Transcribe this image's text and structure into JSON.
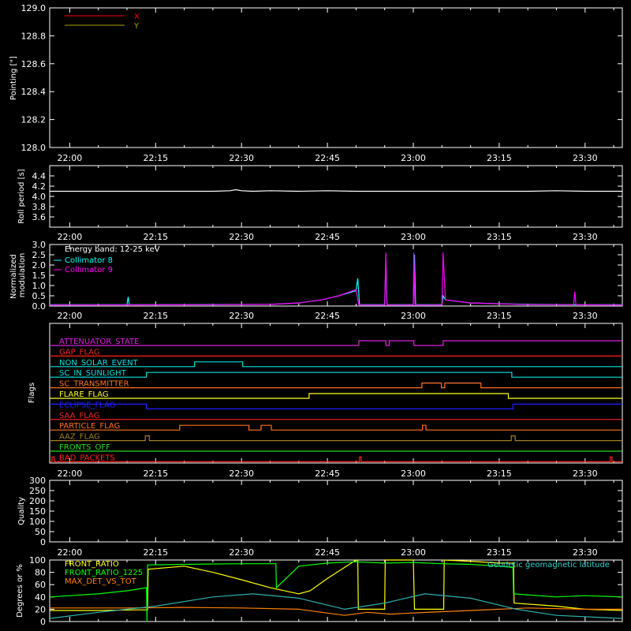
{
  "time_axis": {
    "ticks": [
      "22:00",
      "22:15",
      "22:30",
      "22:45",
      "23:00",
      "23:15",
      "23:30"
    ],
    "tick_minutes": [
      0,
      15,
      30,
      45,
      60,
      75,
      90
    ],
    "range_minutes": [
      -3.5,
      96.5
    ]
  },
  "chart_data": [
    {
      "id": "pointing",
      "type": "line",
      "ylabel": "Pointing [\"]",
      "ylim": [
        128.0,
        129.0
      ],
      "yticks": [
        "128.0",
        "128.2",
        "128.4",
        "128.6",
        "128.8",
        "129.0"
      ],
      "ytick_values": [
        128.0,
        128.2,
        128.4,
        128.6,
        128.8,
        129.0
      ],
      "series": [
        {
          "name": "X",
          "color": "#ff0000",
          "x": [],
          "y": []
        },
        {
          "name": "Y",
          "color": "#b0a000",
          "x": [],
          "y": []
        }
      ],
      "legend": "top-left"
    },
    {
      "id": "roll",
      "type": "line",
      "ylabel": "Roll period [s]",
      "ylim": [
        3.4,
        4.6
      ],
      "yticks": [
        "3.6",
        "3.8",
        "4.0",
        "4.2",
        "4.4"
      ],
      "ytick_values": [
        3.6,
        3.8,
        4.0,
        4.2,
        4.4
      ],
      "series": [
        {
          "color": "#ffffff",
          "x": [
            -3.5,
            5,
            10,
            15,
            20,
            25,
            28,
            29,
            30,
            32,
            35,
            40,
            45,
            50,
            55,
            60,
            65,
            70,
            75,
            80,
            85,
            90,
            96.5
          ],
          "y": [
            4.1,
            4.1,
            4.1,
            4.1,
            4.1,
            4.1,
            4.11,
            4.13,
            4.11,
            4.1,
            4.11,
            4.1,
            4.11,
            4.1,
            4.1,
            4.1,
            4.1,
            4.1,
            4.1,
            4.1,
            4.11,
            4.1,
            4.1
          ]
        }
      ]
    },
    {
      "id": "modulation",
      "type": "line",
      "ylabel": "Normalized modulation",
      "ylim": [
        0.0,
        3.0
      ],
      "yticks": [
        "0.0",
        "0.5",
        "1.0",
        "1.5",
        "2.0",
        "2.5",
        "3.0"
      ],
      "ytick_values": [
        0.0,
        0.5,
        1.0,
        1.5,
        2.0,
        2.5,
        3.0
      ],
      "legend_title": "Energy band: 12-25 keV",
      "series": [
        {
          "name": "Collimator 8",
          "color": "#00ffff",
          "x": [
            -3.5,
            10,
            10.2,
            10.4,
            20,
            35,
            40,
            44,
            47,
            50,
            50.3,
            50.6,
            55,
            55.2,
            55.4,
            60,
            60.2,
            60.4,
            65,
            65.2,
            65.6,
            70,
            80,
            90,
            96.5
          ],
          "y": [
            0.06,
            0.06,
            0.45,
            0.06,
            0.07,
            0.08,
            0.15,
            0.3,
            0.5,
            0.75,
            1.35,
            0.06,
            0.06,
            2.3,
            0.06,
            0.06,
            2.5,
            0.06,
            0.06,
            0.5,
            0.3,
            0.15,
            0.08,
            0.06,
            0.06
          ]
        },
        {
          "name": "Collimator 9",
          "color": "#ff00ff",
          "x": [
            -3.5,
            20,
            35,
            40,
            44,
            47,
            50,
            50.5,
            55,
            55.2,
            55.4,
            60,
            60.1,
            60.3,
            65,
            65.2,
            65.6,
            70,
            80,
            88,
            88.2,
            88.4,
            96.5
          ],
          "y": [
            0.05,
            0.06,
            0.08,
            0.15,
            0.3,
            0.5,
            0.8,
            0.05,
            0.05,
            2.6,
            0.05,
            0.05,
            2.6,
            0.05,
            0.05,
            2.6,
            0.3,
            0.15,
            0.07,
            0.07,
            0.7,
            0.06,
            0.05
          ]
        }
      ]
    },
    {
      "id": "flags",
      "type": "line",
      "ylabel": "Flags",
      "flags": [
        {
          "name": "ATTENUATOR_STATE",
          "color": "#e020e0",
          "x": [
            -3.5,
            50.5,
            50.5,
            55.2,
            55.2,
            55.8,
            55.8,
            60.1,
            60.1,
            65.2,
            65.2,
            96.5
          ],
          "y": [
            0,
            0,
            1,
            1,
            0,
            0,
            1,
            1,
            0,
            0,
            1,
            1,
            0,
            0
          ]
        },
        {
          "name": "GAP_FLAG",
          "color": "#ff2020",
          "x": [
            -3.5,
            96.5
          ],
          "y": [
            0,
            0
          ]
        },
        {
          "name": "NON_SOLAR_EVENT",
          "color": "#00e0e0",
          "x": [
            -3.5,
            21.8,
            21.8,
            22.2,
            22.2,
            30.2,
            30.2,
            96.5
          ],
          "y": [
            0,
            0,
            1,
            1,
            1,
            1,
            0,
            0
          ]
        },
        {
          "name": "SC_IN_SUNLIGHT",
          "color": "#00e0e0",
          "x": [
            -3.5,
            13.4,
            13.4,
            77.2,
            77.2,
            96.5
          ],
          "y": [
            0,
            0,
            1,
            1,
            0,
            0
          ]
        },
        {
          "name": "SC_TRANSMITTER",
          "color": "#ff7020",
          "x": [
            -3.5,
            61.5,
            61.5,
            64.9,
            64.9,
            65.5,
            65.5,
            71.8,
            71.8,
            96.5
          ],
          "y": [
            0,
            0,
            1,
            1,
            0,
            0,
            1,
            1,
            0,
            0
          ]
        },
        {
          "name": "FLARE_FLAG",
          "color": "#ffff20",
          "x": [
            -3.5,
            41.8,
            41.8,
            76.6,
            76.6,
            96.5
          ],
          "y": [
            0,
            0,
            1,
            1,
            0,
            0
          ]
        },
        {
          "name": "ECLIPSE_FLAG",
          "color": "#2020ff",
          "x": [
            -3.5,
            13.4,
            13.4,
            77.4,
            77.4,
            96.5
          ],
          "y": [
            1,
            1,
            0,
            0,
            1,
            1
          ]
        },
        {
          "name": "SAA_FLAG",
          "color": "#ff2020",
          "x": [
            -3.5,
            96.5
          ],
          "y": [
            0,
            0
          ]
        },
        {
          "name": "PARTICLE_FLAG",
          "color": "#ff7020",
          "x": [
            -3.5,
            19.2,
            19.2,
            31.3,
            31.3,
            33.4,
            33.4,
            35.2,
            35.2,
            61.6,
            61.6,
            62.2,
            62.2,
            96.5
          ],
          "y": [
            0,
            0,
            1,
            1,
            0,
            0,
            1,
            1,
            0,
            0,
            1,
            1,
            0,
            0
          ]
        },
        {
          "name": "AAZ_FLAG",
          "color": "#a08020",
          "x": [
            -3.5,
            13.2,
            13.2,
            13.9,
            13.9,
            77.1,
            77.1,
            77.8,
            77.8,
            96.5
          ],
          "y": [
            0,
            0,
            1,
            1,
            0,
            0,
            1,
            1,
            0,
            0
          ]
        },
        {
          "name": "FRONTS_OFF",
          "color": "#20e020",
          "x": [
            -3.5,
            96.5
          ],
          "y": [
            0,
            0
          ]
        },
        {
          "name": "BAD_PACKETS",
          "color": "#ff2020",
          "x": [
            -3.5,
            -3.1,
            -3.1,
            -2.7,
            -2.7,
            50.6,
            50.6,
            50.9,
            50.9,
            94.4,
            94.4,
            94.7,
            94.7,
            96.5
          ],
          "y": [
            0,
            0,
            1,
            1,
            0,
            0,
            1,
            1,
            0,
            0,
            1,
            1,
            0,
            0
          ]
        }
      ]
    },
    {
      "id": "quality",
      "type": "line",
      "ylabel": "Quality",
      "ylim": [
        0,
        300
      ],
      "yticks": [
        "0",
        "50",
        "100",
        "150",
        "200",
        "250",
        "300"
      ],
      "ytick_values": [
        0,
        50,
        100,
        150,
        200,
        250,
        300
      ],
      "series": []
    },
    {
      "id": "ratios",
      "type": "line",
      "ylabel": "Degrees or %",
      "ylim": [
        0,
        100
      ],
      "yticks": [
        "0",
        "20",
        "40",
        "60",
        "80",
        "100"
      ],
      "ytick_values": [
        0,
        20,
        40,
        60,
        80,
        100
      ],
      "series": [
        {
          "name": "FRONT_RATIO",
          "color": "#ffff00",
          "x": [
            -3.5,
            5,
            12,
            13.6,
            13.7,
            20,
            25,
            30,
            35,
            40,
            42,
            45,
            48,
            50,
            50.3,
            50.4,
            55,
            55.1,
            60,
            60.2,
            60.4,
            62,
            65.3,
            65.4,
            70,
            75,
            77.5,
            77.6,
            85,
            90,
            96.5
          ],
          "y": [
            18,
            18,
            19,
            19,
            85,
            90,
            80,
            68,
            55,
            45,
            50,
            70,
            88,
            100,
            100,
            20,
            20,
            100,
            100,
            20,
            20,
            20,
            20,
            100,
            98,
            95,
            95,
            30,
            25,
            20,
            18
          ]
        },
        {
          "name": "FRONT_RATIO_1225",
          "color": "#00ff00",
          "x": [
            -3.5,
            5,
            10,
            13.4,
            13.5,
            13.6,
            20,
            30,
            36,
            36.1,
            40,
            45,
            50,
            55,
            60,
            65,
            70,
            75,
            77.4,
            77.5,
            85,
            90,
            96.5
          ],
          "y": [
            40,
            45,
            50,
            55,
            0,
            92,
            93,
            94,
            94,
            55,
            90,
            95,
            97,
            95,
            96,
            94,
            93,
            90,
            88,
            45,
            40,
            42,
            40
          ]
        },
        {
          "name": "MAX_DET_VS_TOT",
          "color": "#ff8000",
          "x": [
            -3.5,
            10,
            20,
            30,
            40,
            48,
            52,
            56,
            60,
            70,
            80,
            90,
            96.5
          ],
          "y": [
            22,
            22,
            23,
            22,
            20,
            10,
            15,
            12,
            14,
            18,
            22,
            20,
            20
          ]
        },
        {
          "name": "Geodetic geomagnetic latitude",
          "color": "#30b0b0",
          "x": [
            -3.5,
            5,
            15,
            25,
            32,
            40,
            48,
            55,
            62,
            70,
            78,
            85,
            96.5
          ],
          "y": [
            5,
            15,
            25,
            40,
            45,
            38,
            20,
            30,
            45,
            38,
            20,
            10,
            5
          ]
        }
      ]
    }
  ]
}
